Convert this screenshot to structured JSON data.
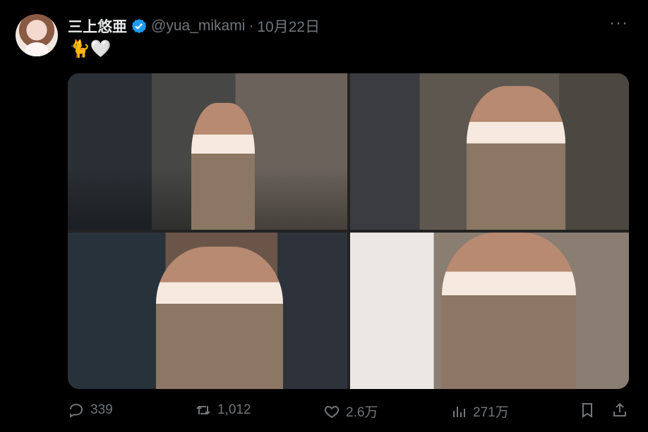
{
  "user": {
    "display_name": "三上悠亜",
    "handle": "@yua_mikami",
    "separator": "·",
    "time": "10月22日",
    "verified_icon": "verified-badge-icon",
    "avatar_icon": "profile-avatar"
  },
  "tweet": {
    "text": "🐈🤍"
  },
  "media": {
    "photos": [
      "photo-1",
      "photo-2",
      "photo-3",
      "photo-4"
    ]
  },
  "actions": {
    "reply_count": "339",
    "retweet_count": "1,012",
    "like_count": "2.6万",
    "view_count": "271万"
  },
  "colors": {
    "background": "#000000",
    "text": "#e7e9ea",
    "muted": "#71767b",
    "verified": "#1d9bf0"
  }
}
